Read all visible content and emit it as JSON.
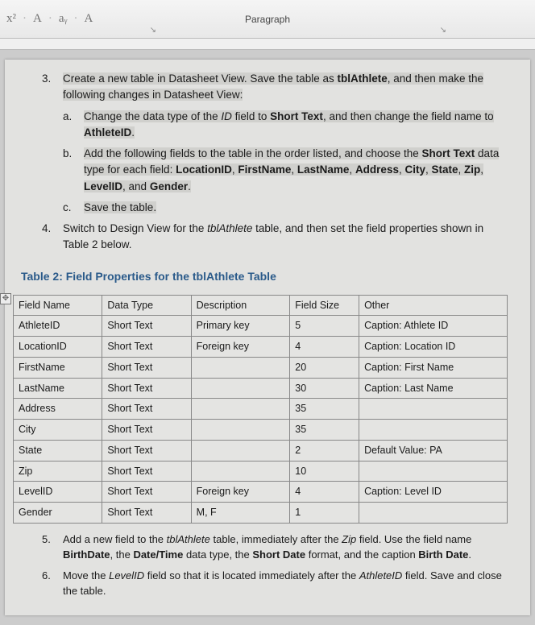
{
  "toolbar": {
    "items": [
      "x²",
      "A",
      "aᵧ",
      "A"
    ],
    "group_label": "Paragraph"
  },
  "instructions": {
    "item3": {
      "num": "3.",
      "lead": "Create a new table in Datasheet View. Save the table as ",
      "bold1": "tblAthlete",
      "tail1": ", and then make the following changes in Datasheet View:",
      "a": {
        "letter": "a.",
        "p1": "Change the data type of the ",
        "i1": "ID",
        "p2": " field to ",
        "b1": "Short Text",
        "p3": ", and then change the field name to ",
        "b2": "AthleteID",
        "p4": "."
      },
      "b": {
        "letter": "b.",
        "p1": "Add the following fields to the table in the order listed, and choose the ",
        "b1": "Short Text",
        "p2": " data type for each field: ",
        "b2": "LocationID",
        "s1": ", ",
        "b3": "FirstName",
        "s2": ", ",
        "b4": "LastName",
        "s3": ", ",
        "b5": "Address",
        "s4": ", ",
        "b6": "City",
        "s5": ", ",
        "b7": "State",
        "s6": ", ",
        "b8": "Zip",
        "s7": ", ",
        "b9": "LevelID",
        "s8": ", and ",
        "b10": "Gender",
        "s9": "."
      },
      "c": {
        "letter": "c.",
        "text": "Save the table."
      }
    },
    "item4": {
      "num": "4.",
      "p1": "Switch to Design View for the ",
      "i1": "tblAthlete",
      "p2": " table, and then set the field properties shown in Table 2 below."
    }
  },
  "table_title": "Table 2: Field Properties for the tblAthlete Table",
  "table": {
    "headers": [
      "Field Name",
      "Data Type",
      "Description",
      "Field Size",
      "Other"
    ],
    "rows": [
      [
        "AthleteID",
        "Short Text",
        "Primary key",
        "5",
        "Caption: Athlete ID"
      ],
      [
        "LocationID",
        "Short Text",
        "Foreign key",
        "4",
        "Caption: Location ID"
      ],
      [
        "FirstName",
        "Short Text",
        "",
        "20",
        "Caption: First Name"
      ],
      [
        "LastName",
        "Short Text",
        "",
        "30",
        "Caption: Last Name"
      ],
      [
        "Address",
        "Short Text",
        "",
        "35",
        ""
      ],
      [
        "City",
        "Short Text",
        "",
        "35",
        ""
      ],
      [
        "State",
        "Short Text",
        "",
        "2",
        "Default Value: PA"
      ],
      [
        "Zip",
        "Short Text",
        "",
        "10",
        ""
      ],
      [
        "LevelID",
        "Short Text",
        "Foreign key",
        "4",
        "Caption: Level ID"
      ],
      [
        "Gender",
        "Short Text",
        "M, F",
        "1",
        ""
      ]
    ]
  },
  "post": {
    "item5": {
      "num": "5.",
      "p1": "Add a new field to the ",
      "i1": "tblAthlete",
      "p2": " table, immediately after the ",
      "i2": "Zip",
      "p3": " field. Use the field name ",
      "b1": "BirthDate",
      "p4": ", the ",
      "b2": "Date/Time",
      "p5": " data type, the ",
      "b3": "Short Date",
      "p6": " format, and the caption ",
      "b4": "Birth Date",
      "p7": "."
    },
    "item6": {
      "num": "6.",
      "p1": "Move the ",
      "i1": "LevelID",
      "p2": " field so that it is located immediately after the ",
      "i2": "AthleteID",
      "p3": " field. Save and close the table."
    }
  }
}
